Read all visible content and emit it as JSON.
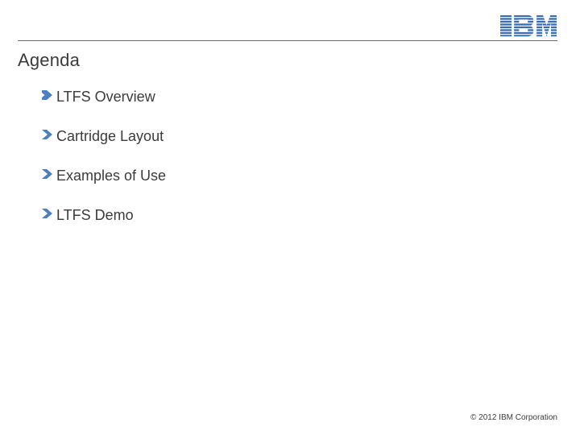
{
  "brand": {
    "logo_name": "ibm-logo",
    "color": "#3b6db3"
  },
  "slide": {
    "title": "Agenda",
    "bullets": [
      "LTFS Overview",
      "Cartridge Layout",
      "Examples of Use",
      "LTFS Demo"
    ]
  },
  "footer": {
    "copyright": "© 2012 IBM Corporation"
  },
  "style": {
    "arrow_color": "#4c7fbf"
  }
}
